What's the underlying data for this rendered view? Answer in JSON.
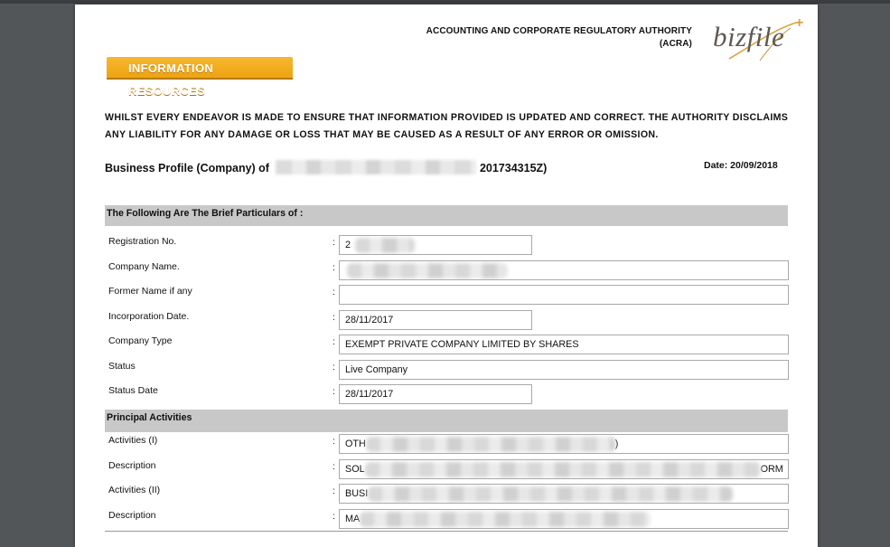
{
  "header": {
    "authority_line1": "ACCOUNTING AND CORPORATE REGULATORY AUTHORITY",
    "authority_line2": "(ACRA)",
    "logo_text": "bizfile",
    "logo_plus": "+",
    "banner": "INFORMATION RESOURCES"
  },
  "disclaimer": "WHILST EVERY ENDEAVOR IS MADE TO ENSURE THAT INFORMATION PROVIDED IS UPDATED AND CORRECT. THE AUTHORITY DISCLAIMS ANY LIABILITY FOR ANY DAMAGE OR LOSS THAT MAY BE CAUSED AS A RESULT OF ANY ERROR OR OMISSION.",
  "profile": {
    "title_prefix": "Business Profile (Company) of",
    "title_suffix": "201734315Z)",
    "date": "Date: 20/09/2018"
  },
  "sections": {
    "particulars": "The Following Are The Brief Particulars of :",
    "principal": "Principal Activities"
  },
  "fields": {
    "registration_no": {
      "label": "Registration No.",
      "value": "2"
    },
    "company_name": {
      "label": "Company Name.",
      "value": ""
    },
    "former_name": {
      "label": "Former Name if any",
      "value": ""
    },
    "incorporation_date": {
      "label": "Incorporation Date.",
      "value": "28/11/2017"
    },
    "company_type": {
      "label": "Company Type",
      "value": "EXEMPT PRIVATE COMPANY LIMITED BY SHARES"
    },
    "status": {
      "label": "Status",
      "value": "Live Company"
    },
    "status_date": {
      "label": "Status Date",
      "value": "28/11/2017"
    },
    "activities_1": {
      "label": "Activities (I)",
      "value": "OTH",
      "tail": ")"
    },
    "description_1": {
      "label": "Description",
      "value": "SOL",
      "tail": "ORM"
    },
    "activities_2": {
      "label": "Activities (II)",
      "value": "BUSI",
      "tail": ""
    },
    "description_2": {
      "label": "Description",
      "value": "MA",
      "tail": ""
    }
  },
  "colon": ":"
}
